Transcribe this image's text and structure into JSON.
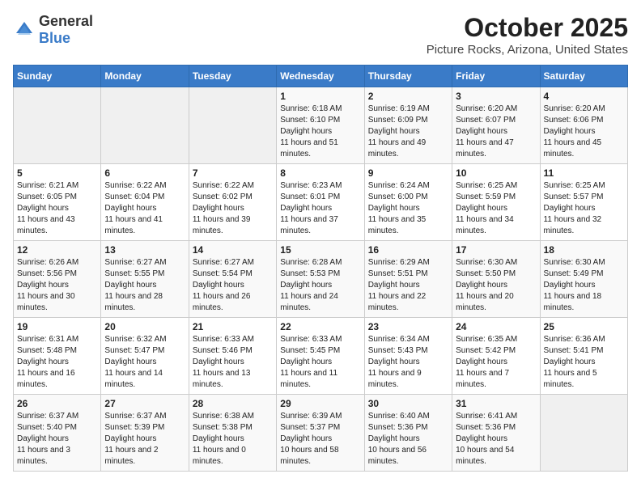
{
  "header": {
    "logo_general": "General",
    "logo_blue": "Blue",
    "month": "October 2025",
    "location": "Picture Rocks, Arizona, United States"
  },
  "weekdays": [
    "Sunday",
    "Monday",
    "Tuesday",
    "Wednesday",
    "Thursday",
    "Friday",
    "Saturday"
  ],
  "weeks": [
    [
      {
        "day": "",
        "empty": true
      },
      {
        "day": "",
        "empty": true
      },
      {
        "day": "",
        "empty": true
      },
      {
        "day": "1",
        "sunrise": "6:18 AM",
        "sunset": "6:10 PM",
        "daylight": "11 hours and 51 minutes."
      },
      {
        "day": "2",
        "sunrise": "6:19 AM",
        "sunset": "6:09 PM",
        "daylight": "11 hours and 49 minutes."
      },
      {
        "day": "3",
        "sunrise": "6:20 AM",
        "sunset": "6:07 PM",
        "daylight": "11 hours and 47 minutes."
      },
      {
        "day": "4",
        "sunrise": "6:20 AM",
        "sunset": "6:06 PM",
        "daylight": "11 hours and 45 minutes."
      }
    ],
    [
      {
        "day": "5",
        "sunrise": "6:21 AM",
        "sunset": "6:05 PM",
        "daylight": "11 hours and 43 minutes."
      },
      {
        "day": "6",
        "sunrise": "6:22 AM",
        "sunset": "6:04 PM",
        "daylight": "11 hours and 41 minutes."
      },
      {
        "day": "7",
        "sunrise": "6:22 AM",
        "sunset": "6:02 PM",
        "daylight": "11 hours and 39 minutes."
      },
      {
        "day": "8",
        "sunrise": "6:23 AM",
        "sunset": "6:01 PM",
        "daylight": "11 hours and 37 minutes."
      },
      {
        "day": "9",
        "sunrise": "6:24 AM",
        "sunset": "6:00 PM",
        "daylight": "11 hours and 35 minutes."
      },
      {
        "day": "10",
        "sunrise": "6:25 AM",
        "sunset": "5:59 PM",
        "daylight": "11 hours and 34 minutes."
      },
      {
        "day": "11",
        "sunrise": "6:25 AM",
        "sunset": "5:57 PM",
        "daylight": "11 hours and 32 minutes."
      }
    ],
    [
      {
        "day": "12",
        "sunrise": "6:26 AM",
        "sunset": "5:56 PM",
        "daylight": "11 hours and 30 minutes."
      },
      {
        "day": "13",
        "sunrise": "6:27 AM",
        "sunset": "5:55 PM",
        "daylight": "11 hours and 28 minutes."
      },
      {
        "day": "14",
        "sunrise": "6:27 AM",
        "sunset": "5:54 PM",
        "daylight": "11 hours and 26 minutes."
      },
      {
        "day": "15",
        "sunrise": "6:28 AM",
        "sunset": "5:53 PM",
        "daylight": "11 hours and 24 minutes."
      },
      {
        "day": "16",
        "sunrise": "6:29 AM",
        "sunset": "5:51 PM",
        "daylight": "11 hours and 22 minutes."
      },
      {
        "day": "17",
        "sunrise": "6:30 AM",
        "sunset": "5:50 PM",
        "daylight": "11 hours and 20 minutes."
      },
      {
        "day": "18",
        "sunrise": "6:30 AM",
        "sunset": "5:49 PM",
        "daylight": "11 hours and 18 minutes."
      }
    ],
    [
      {
        "day": "19",
        "sunrise": "6:31 AM",
        "sunset": "5:48 PM",
        "daylight": "11 hours and 16 minutes."
      },
      {
        "day": "20",
        "sunrise": "6:32 AM",
        "sunset": "5:47 PM",
        "daylight": "11 hours and 14 minutes."
      },
      {
        "day": "21",
        "sunrise": "6:33 AM",
        "sunset": "5:46 PM",
        "daylight": "11 hours and 13 minutes."
      },
      {
        "day": "22",
        "sunrise": "6:33 AM",
        "sunset": "5:45 PM",
        "daylight": "11 hours and 11 minutes."
      },
      {
        "day": "23",
        "sunrise": "6:34 AM",
        "sunset": "5:43 PM",
        "daylight": "11 hours and 9 minutes."
      },
      {
        "day": "24",
        "sunrise": "6:35 AM",
        "sunset": "5:42 PM",
        "daylight": "11 hours and 7 minutes."
      },
      {
        "day": "25",
        "sunrise": "6:36 AM",
        "sunset": "5:41 PM",
        "daylight": "11 hours and 5 minutes."
      }
    ],
    [
      {
        "day": "26",
        "sunrise": "6:37 AM",
        "sunset": "5:40 PM",
        "daylight": "11 hours and 3 minutes."
      },
      {
        "day": "27",
        "sunrise": "6:37 AM",
        "sunset": "5:39 PM",
        "daylight": "11 hours and 2 minutes."
      },
      {
        "day": "28",
        "sunrise": "6:38 AM",
        "sunset": "5:38 PM",
        "daylight": "11 hours and 0 minutes."
      },
      {
        "day": "29",
        "sunrise": "6:39 AM",
        "sunset": "5:37 PM",
        "daylight": "10 hours and 58 minutes."
      },
      {
        "day": "30",
        "sunrise": "6:40 AM",
        "sunset": "5:36 PM",
        "daylight": "10 hours and 56 minutes."
      },
      {
        "day": "31",
        "sunrise": "6:41 AM",
        "sunset": "5:36 PM",
        "daylight": "10 hours and 54 minutes."
      },
      {
        "day": "",
        "empty": true
      }
    ]
  ],
  "labels": {
    "sunrise_prefix": "Sunrise: ",
    "sunset_prefix": "Sunset: ",
    "daylight_label": "Daylight hours"
  }
}
